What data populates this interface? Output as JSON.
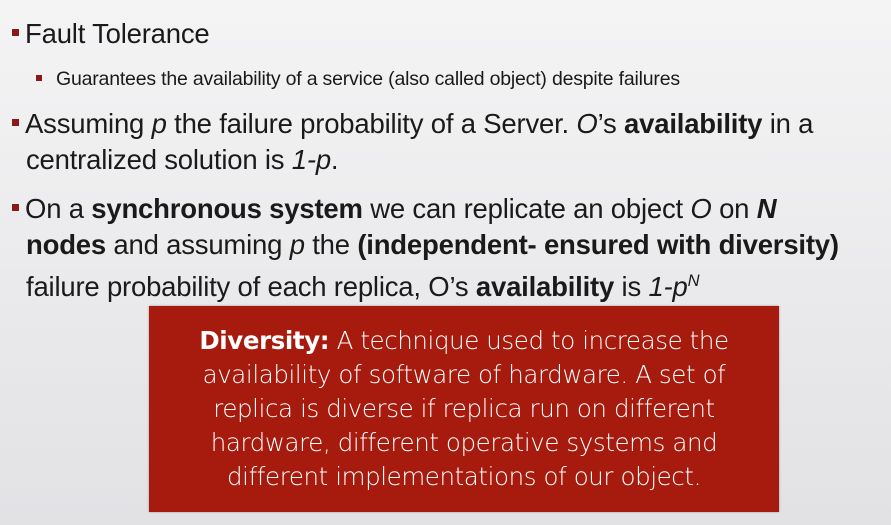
{
  "accent_color": "#a61b0e",
  "bullets": {
    "b1": {
      "text": "Fault Tolerance"
    },
    "b1_sub": {
      "text": "Guarantees the availability of a service (also called object) despite failures"
    },
    "b2": {
      "t1": "Assuming ",
      "p": "p",
      "t2": " the failure probability of a Server.  ",
      "o": "O",
      "t3": "’s ",
      "strong": "availability",
      "t4": " in a centralized solution is ",
      "formula": "1-p",
      "t5": "."
    },
    "b3": {
      "t1": "On a ",
      "s1": "synchronous system",
      "t2": " we can replicate an object ",
      "o": "O",
      "t3": " on ",
      "n": "N",
      "s2": "nodes",
      "t4": " and assuming ",
      "p": "p",
      "t5": " the ",
      "s3": "(independent- ensured with diversity)",
      "t6": " failure probability of each replica, O’s ",
      "s4": "availability",
      "t7": " is ",
      "f1": "1-p",
      "exp": "N"
    }
  },
  "callout": {
    "heading": "Diversity:",
    "body": " A technique used to increase the availability of software of hardware. A set of replica is diverse if replica run on different hardware, different operative systems and different implementations of our object."
  }
}
